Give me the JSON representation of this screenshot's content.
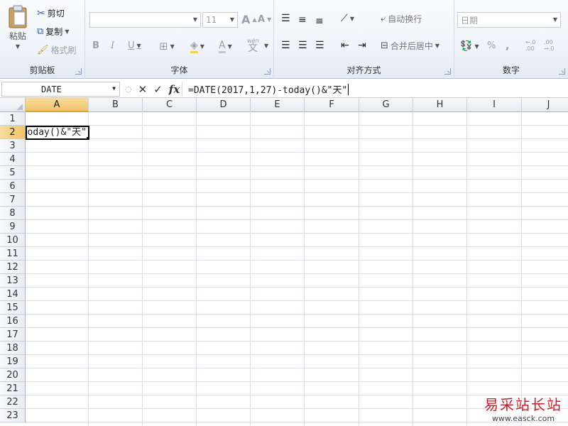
{
  "ribbon": {
    "clipboard": {
      "label": "剪贴板",
      "paste": "粘贴",
      "cut": "剪切",
      "copy": "复制",
      "format_painter": "格式刷"
    },
    "font": {
      "label": "字体",
      "font_name": "",
      "font_size": "11",
      "bold": "B",
      "italic": "I",
      "underline": "U",
      "grow": "A",
      "shrink": "A",
      "font_color": "A",
      "wen": "wén"
    },
    "alignment": {
      "label": "对齐方式",
      "wrap_text": "自动换行",
      "merge_center": "合并后居中"
    },
    "number": {
      "label": "数字",
      "format": "日期",
      "percent": "%",
      "comma": ",",
      "inc_decimal": "←.0\n.00",
      "dec_decimal": ".00\n→.0"
    }
  },
  "formula_bar": {
    "name_box": "DATE",
    "cancel": "✕",
    "enter": "✓",
    "fx": "fx",
    "formula": "=DATE(2017,1,27)-today()&\"天\""
  },
  "columns": [
    "A",
    "B",
    "C",
    "D",
    "E",
    "F",
    "G",
    "H",
    "I",
    "J"
  ],
  "rows": [
    "1",
    "2",
    "3",
    "4",
    "5",
    "6",
    "7",
    "8",
    "9",
    "10",
    "11",
    "12",
    "13",
    "14",
    "15",
    "16",
    "17",
    "18",
    "19",
    "20",
    "21",
    "22",
    "23"
  ],
  "active_column": "A",
  "active_row": "2",
  "active_cell_text": "=DATE(2017,1,27)-today()&\"天\"",
  "watermark": {
    "title": "易采站长站",
    "url": "www.easck.com"
  }
}
